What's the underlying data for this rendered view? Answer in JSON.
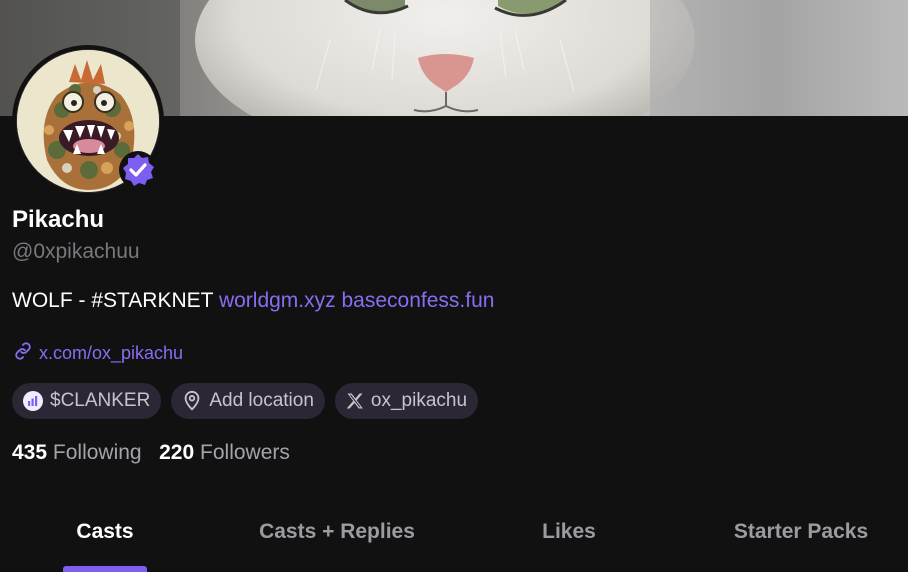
{
  "profile": {
    "display_name": "Pikachu",
    "handle": "@0xpikachuu",
    "bio_text": "WOLF - #STARKNET",
    "bio_links": [
      "worldgm.xyz",
      "baseconfess.fun"
    ],
    "website": "x.com/ox_pikachu",
    "verified": true
  },
  "chips": {
    "token": "$CLANKER",
    "location": "Add location",
    "x_account": "ox_pikachu"
  },
  "stats": {
    "following_count": "435",
    "following_label": "Following",
    "followers_count": "220",
    "followers_label": "Followers"
  },
  "tabs": [
    "Casts",
    "Casts + Replies",
    "Likes",
    "Starter Packs"
  ],
  "active_tab": "Casts",
  "colors": {
    "background": "#121112",
    "accent": "#8a6cf2",
    "chip_bg": "#2b2734",
    "tab_indicator": "#7c5ff0"
  },
  "icons": [
    "verified-badge-icon",
    "link-icon",
    "token-icon",
    "location-pin-icon",
    "x-logo-icon"
  ]
}
